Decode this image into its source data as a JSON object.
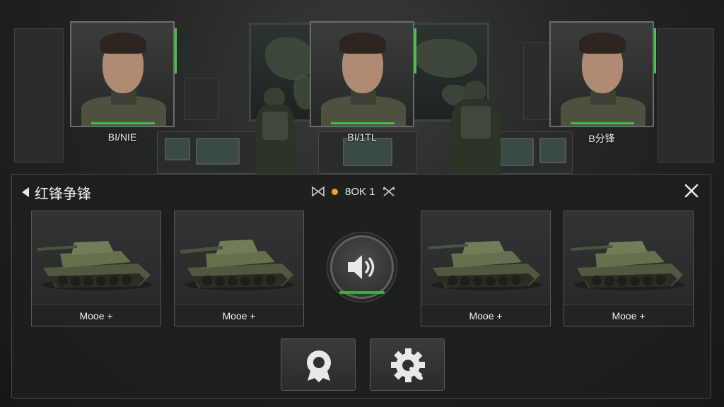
{
  "portraits": [
    {
      "name": "BI/NIE"
    },
    {
      "name": "BI/1TL"
    },
    {
      "name": "B分锋"
    }
  ],
  "panel": {
    "title": "红锋争锋",
    "status_text": "8OK 1"
  },
  "tanks": [
    {
      "label": "Mooe +"
    },
    {
      "label": "Mooe +"
    },
    {
      "label": "Mooe +"
    },
    {
      "label": "Mooe +"
    }
  ],
  "icons": {
    "back": "back-arrow-icon",
    "status_left": "bowtie-icon",
    "status_right": "crossed-swords-icon",
    "close": "close-icon",
    "sound": "speaker-icon",
    "profile": "profile-badge-icon",
    "settings": "settings-gear-icon"
  },
  "colors": {
    "accent_green": "#3fbf3f",
    "status_orange": "#f0a21c"
  }
}
